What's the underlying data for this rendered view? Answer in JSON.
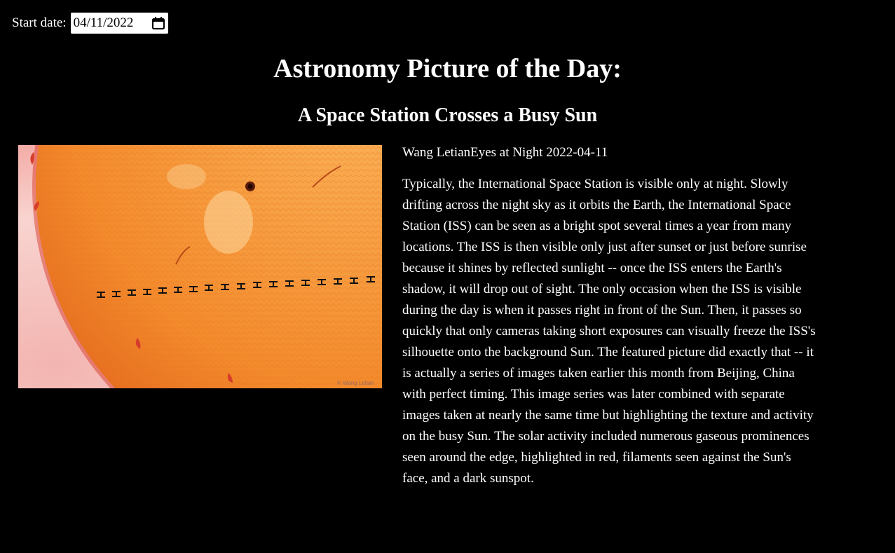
{
  "date_picker": {
    "label": "Start date:",
    "value": "04/11/2022",
    "icon": "calendar-icon"
  },
  "header": {
    "title": "Astronomy Picture of the Day:",
    "subtitle": "A Space Station Crosses a Busy Sun"
  },
  "image": {
    "credit_watermark": "© Wang Letian"
  },
  "article": {
    "byline": "Wang LetianEyes at Night 2022-04-11",
    "explanation": "Typically, the International Space Station is visible only at night. Slowly drifting across the night sky as it orbits the Earth, the International Space Station (ISS) can be seen as a bright spot several times a year from many locations. The ISS is then visible only just after sunset or just before sunrise because it shines by reflected sunlight -- once the ISS enters the Earth's shadow, it will drop out of sight. The only occasion when the ISS is visible during the day is when it passes right in front of the Sun. Then, it passes so quickly that only cameras taking short exposures can visually freeze the ISS's silhouette onto the background Sun. The featured picture did exactly that -- it is actually a series of images taken earlier this month from Beijing, China with perfect timing. This image series was later combined with separate images taken at nearly the same time but highlighting the texture and activity on the busy Sun. The solar activity included numerous gaseous prominences seen around the edge, highlighted in red, filaments seen against the Sun's face, and a dark sunspot."
  },
  "colors": {
    "background": "#000000",
    "text": "#ffffff",
    "sun": "#f08a2c",
    "sky": "#f7c9c6"
  }
}
